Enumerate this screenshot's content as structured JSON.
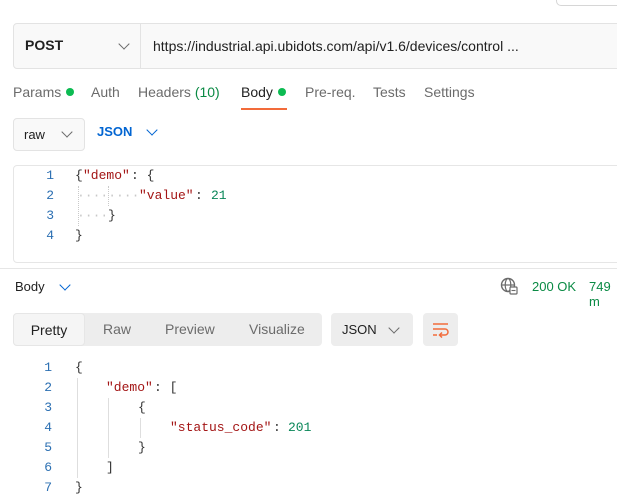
{
  "request": {
    "method": "POST",
    "url": "https://industrial.api.ubidots.com/api/v1.6/devices/control ..."
  },
  "tabs": [
    {
      "label": "Params",
      "has_dot": true
    },
    {
      "label": "Auth"
    },
    {
      "label": "Headers",
      "count": "(10)"
    },
    {
      "label": "Body",
      "has_dot": true,
      "active": true
    },
    {
      "label": "Pre-req."
    },
    {
      "label": "Tests"
    },
    {
      "label": "Settings"
    }
  ],
  "body_options": {
    "mode": "raw",
    "language": "JSON"
  },
  "request_body": {
    "line_numbers": [
      "1",
      "2",
      "3",
      "4"
    ],
    "key_demo": "\"demo\"",
    "key_value": "\"value\"",
    "value": "21"
  },
  "response": {
    "title": "Body",
    "status": "200 OK",
    "time": "749 m",
    "view_tabs": [
      "Pretty",
      "Raw",
      "Preview",
      "Visualize"
    ],
    "format": "JSON",
    "line_numbers": [
      "1",
      "2",
      "3",
      "4",
      "5",
      "6",
      "7"
    ],
    "key_demo": "\"demo\"",
    "key_status": "\"status_code\"",
    "status_value": "201"
  },
  "colors": {
    "accent": "#f26b3a",
    "dot_green": "#0cbb52",
    "link_blue": "#0265d2",
    "status_green": "#0a8a44"
  },
  "icons": [
    "chevron-down-icon",
    "globe-icon",
    "wrap-lines-icon"
  ]
}
